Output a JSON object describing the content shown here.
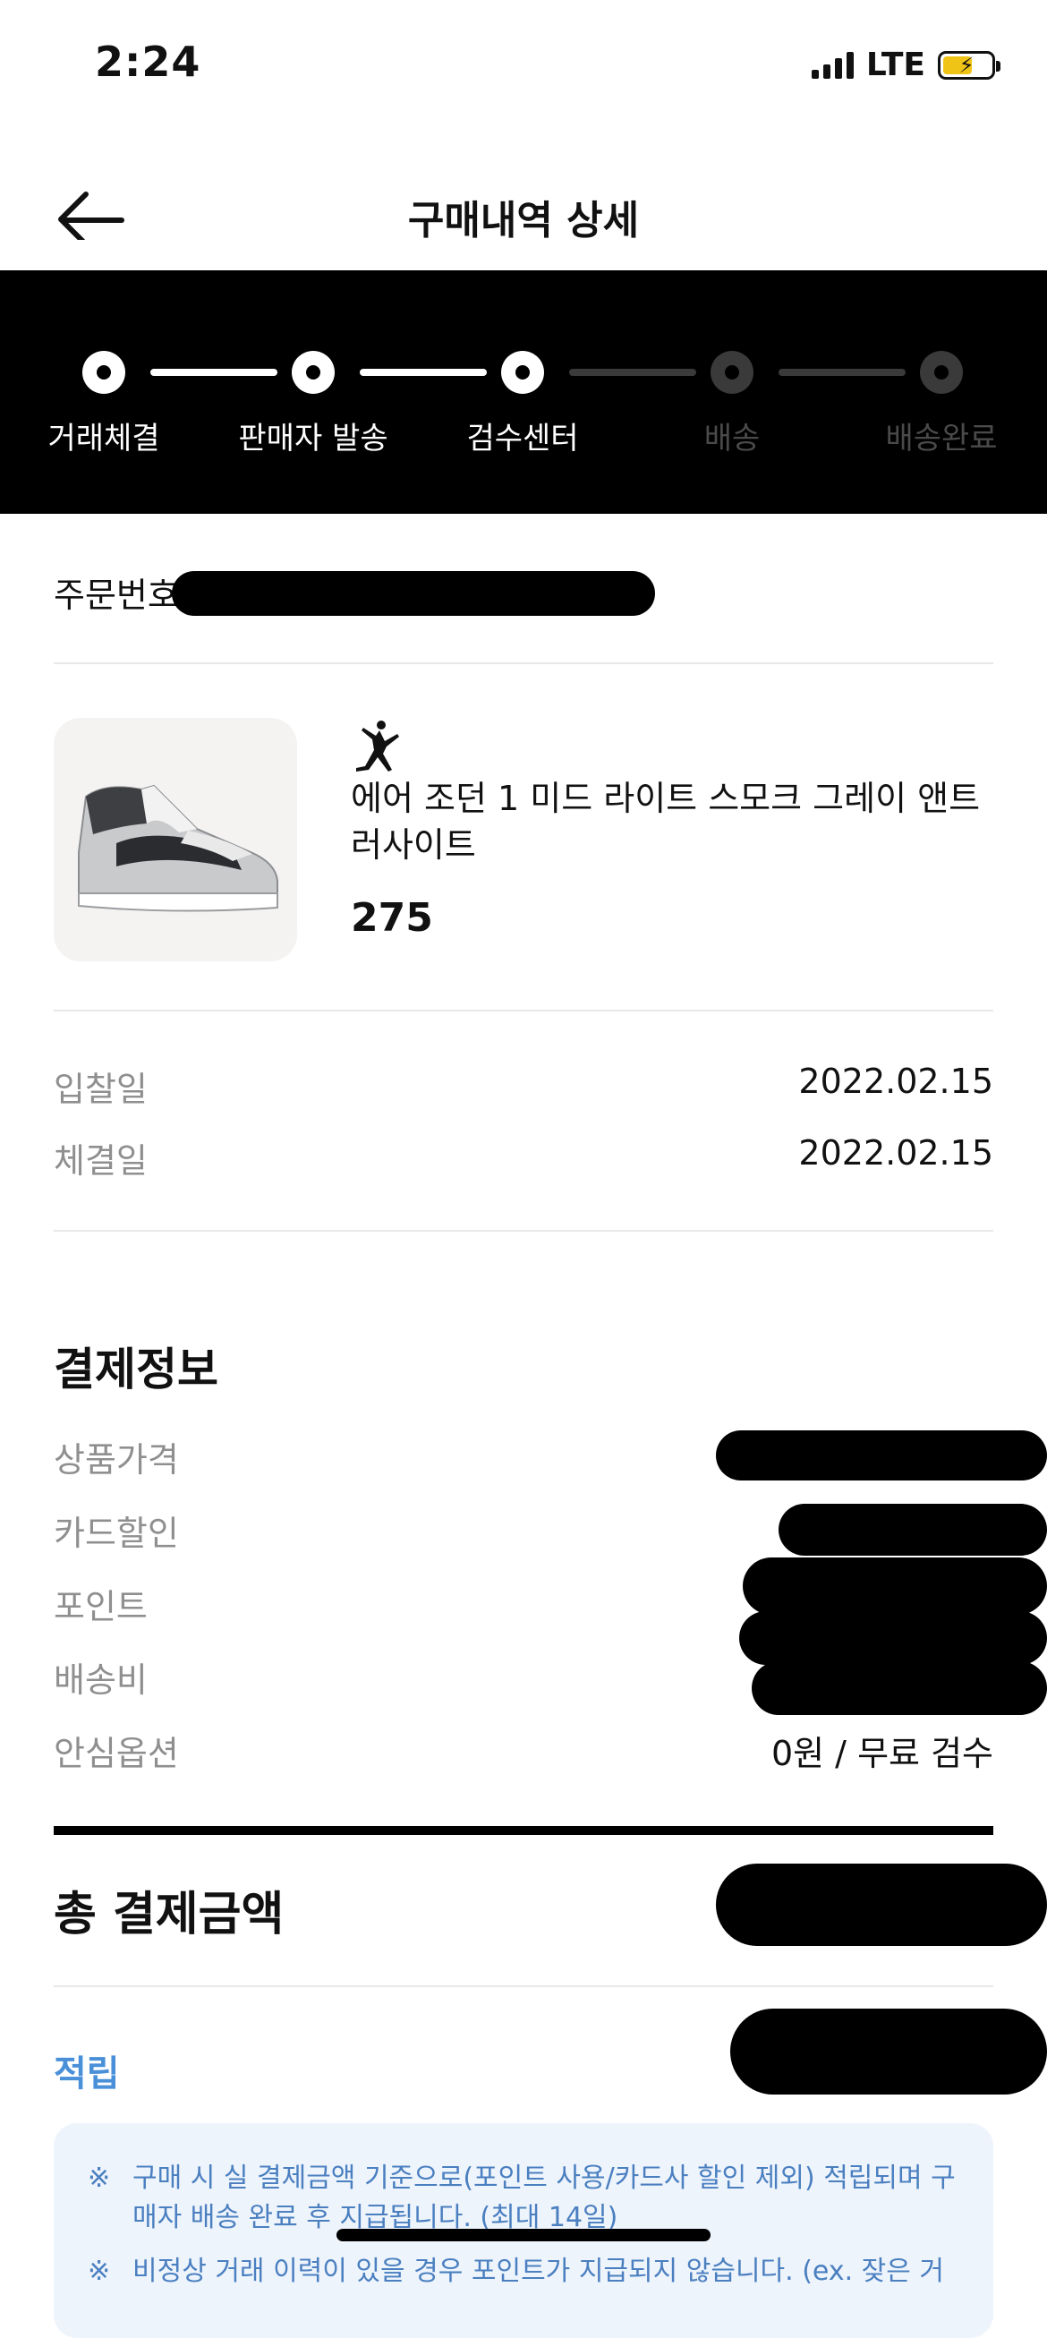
{
  "status_bar": {
    "time": "2:24",
    "network": "LTE"
  },
  "header": {
    "title": "구매내역 상세"
  },
  "progress_steps": [
    {
      "label": "거래체결",
      "done": true
    },
    {
      "label": "판매자 발송",
      "done": true
    },
    {
      "label": "검수센터",
      "done": true
    },
    {
      "label": "배송",
      "done": false
    },
    {
      "label": "배송완료",
      "done": false
    }
  ],
  "order": {
    "number_label": "주문번호"
  },
  "product": {
    "brand_icon": "jordan-jumpman-logo",
    "name": "에어 조던 1 미드 라이트 스모크 그레이 앤트러사이트",
    "size": "275"
  },
  "dates": [
    {
      "label": "입찰일",
      "value": "2022.02.15"
    },
    {
      "label": "체결일",
      "value": "2022.02.15"
    }
  ],
  "payment": {
    "title": "결제정보",
    "rows": [
      {
        "label": "상품가격",
        "value": ""
      },
      {
        "label": "카드할인",
        "value": ""
      },
      {
        "label": "포인트",
        "value": ""
      },
      {
        "label": "배송비",
        "value": ""
      },
      {
        "label": "안심옵션",
        "value": "0원 / 무료 검수"
      }
    ],
    "total_label": "총 결제금액"
  },
  "points": {
    "title": "적립",
    "notices": [
      "구매 시 실 결제금액 기준으로(포인트 사용/카드사 할인 제외) 적립되며 구매자 배송 완료 후 지급됩니다. (최대 14일)",
      "비정상 거래 이력이 있을 경우 포인트가 지급되지 않습니다. (ex. 잦은 거"
    ]
  },
  "colors": {
    "progress_bg": "#000000",
    "accent_blue": "#4a90d9",
    "muted_text": "#8f8f8f"
  }
}
